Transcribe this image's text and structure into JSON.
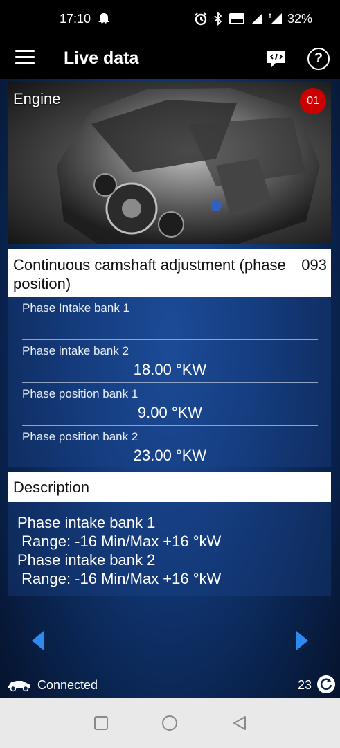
{
  "status_bar": {
    "time": "17:10",
    "battery": "32%",
    "icons": [
      "ghost-icon",
      "alarm-icon",
      "bluetooth-icon",
      "volte-icon",
      "signal-icon",
      "4g-signal-icon"
    ]
  },
  "app_bar": {
    "title": "Live data",
    "icons": [
      "menu-icon",
      "code-icon",
      "help-icon"
    ]
  },
  "engine_card": {
    "label": "Engine",
    "ecu_address": "01"
  },
  "group": {
    "title": "Continuous camshaft adjustment (phase position)",
    "number": "093",
    "rows": [
      {
        "label": "Phase Intake bank 1",
        "value": ""
      },
      {
        "label": "Phase intake bank 2",
        "value": "18.00 °KW"
      },
      {
        "label": "Phase position bank 1",
        "value": "9.00 °KW"
      },
      {
        "label": "Phase position bank 2",
        "value": "23.00 °KW"
      }
    ]
  },
  "description": {
    "title": "Description",
    "lines": [
      "Phase intake bank 1",
      " Range: -16 Min/Max +16 °kW",
      "Phase intake bank 2",
      " Range: -16 Min/Max +16 °kW"
    ]
  },
  "footer": {
    "connection_status": "Connected",
    "count": "23"
  },
  "colors": {
    "accent_arrow": "#2f8af0",
    "badge_red": "#cc0000",
    "background_blue": "#123a7a"
  }
}
